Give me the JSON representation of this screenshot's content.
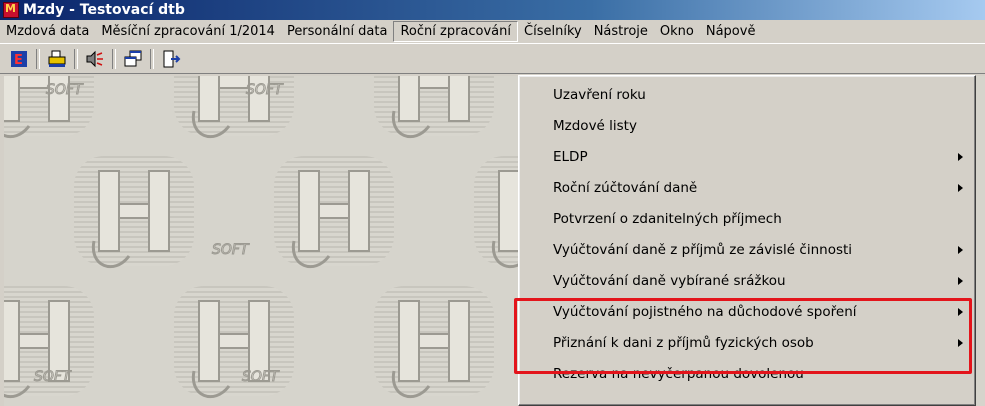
{
  "window": {
    "title": "Mzdy - Testovací dtb",
    "app_icon": "mzdy-app-icon"
  },
  "menubar": {
    "items": [
      {
        "label": "Mzdová data"
      },
      {
        "label": "Měsíční zpracování 1/2014"
      },
      {
        "label": "Personální data"
      },
      {
        "label": "Roční zpracování",
        "active": true
      },
      {
        "label": "Číselníky"
      },
      {
        "label": "Nástroje"
      },
      {
        "label": "Okno"
      },
      {
        "label": "Nápově"
      }
    ]
  },
  "toolbar": {
    "buttons": [
      "e-document-icon",
      "printer-icon",
      "speaker-icon",
      "windows-cascade-icon",
      "exit-door-icon"
    ]
  },
  "workspace": {
    "watermark_text": "SOFT"
  },
  "dropdown": {
    "items": [
      {
        "label": "Uzavření roku",
        "submenu": false
      },
      {
        "label": "Mzdové listy",
        "submenu": false
      },
      {
        "label": "ELDP",
        "submenu": true
      },
      {
        "label": "Roční zúčtování daně",
        "submenu": true
      },
      {
        "label": "Potvrzení o zdanitelných příjmech",
        "submenu": false
      },
      {
        "label": "Vyúčtování daně z příjmů ze závislé činnosti",
        "submenu": true
      },
      {
        "label": "Vyúčtování daně vybírané srážkou",
        "submenu": true
      },
      {
        "label": "Vyúčtování pojistného na důchodové spoření",
        "submenu": true
      },
      {
        "label": "Přiznání k dani z příjmů fyzických osob",
        "submenu": true
      },
      {
        "label": "Rezerva na nevyčerpanou dovolenou",
        "submenu": false
      }
    ],
    "highlight_color": "#e3141b"
  }
}
